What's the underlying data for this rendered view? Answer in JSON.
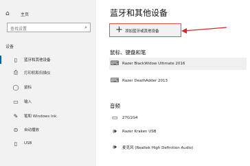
{
  "sidebar": {
    "home_label": "主页",
    "search_placeholder": "查找设置",
    "section_label": "设备",
    "items": [
      {
        "label": "蓝牙和其他设备",
        "icon": "bluetooth-icon"
      },
      {
        "label": "打印机和扫描仪",
        "icon": "printer-icon"
      },
      {
        "label": "鼠标",
        "icon": "mouse-icon"
      },
      {
        "label": "输入",
        "icon": "keyboard-icon"
      },
      {
        "label": "笔和 Windows Ink",
        "icon": "pen-icon"
      },
      {
        "label": "自动播放",
        "icon": "autoplay-icon"
      },
      {
        "label": "USB",
        "icon": "usb-icon"
      }
    ]
  },
  "main": {
    "title": "蓝牙和其他设备",
    "add_button_label": "添加蓝牙或其他设备",
    "sections": {
      "mouse_keyboard_pen": "鼠标、键盘和笔",
      "audio": "音频"
    },
    "devices": {
      "kb1": "Razer BlackWidow Ultimate 2016",
      "m1": "Razer DeathAdder 2013",
      "mon": "27G1G4",
      "spk1": "Razer Kraken USB",
      "spk2": "麦克风 (Realtek High Definition Audio)"
    }
  },
  "colors": {
    "accent": "#0063b1",
    "highlight_box": "#e05050",
    "arrow": "#d82828"
  }
}
